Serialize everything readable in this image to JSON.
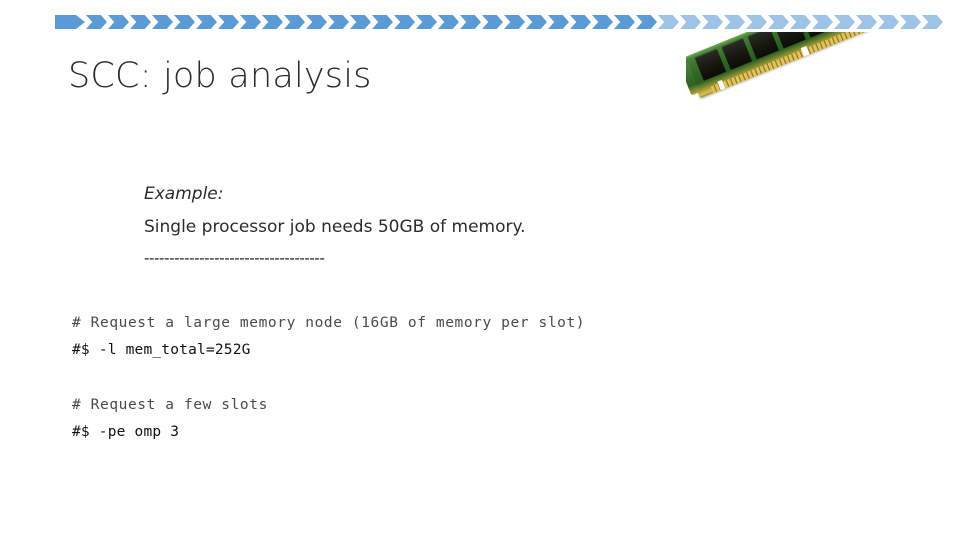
{
  "slide": {
    "title": "SCC: job analysis",
    "background_color": "#ffffff"
  },
  "decoration": {
    "chevron_band": {
      "name": "chevron-band",
      "dark_color": "#5b9bd5",
      "light_color": "#9dc3e6",
      "total_chevrons": 40,
      "dark_count": 27
    },
    "image": {
      "name": "ram-memory-module-photo",
      "alt": "Green DDR RAM memory module with black chips and gold contact pins",
      "pcb_color": "#2f6524",
      "chip_color": "#16170f",
      "pin_color": "#d9bf55"
    }
  },
  "content": {
    "example_label": "Example:",
    "example_sentence": "Single processor job needs 50GB of memory.",
    "divider": "------------------------------------"
  },
  "code": {
    "block_one": {
      "comment": "# Request a large memory node (16GB of memory per slot)",
      "command": "#$ -l mem_total=252G"
    },
    "block_two": {
      "comment": "# Request a few slots",
      "command": "#$ -pe omp 3"
    }
  }
}
